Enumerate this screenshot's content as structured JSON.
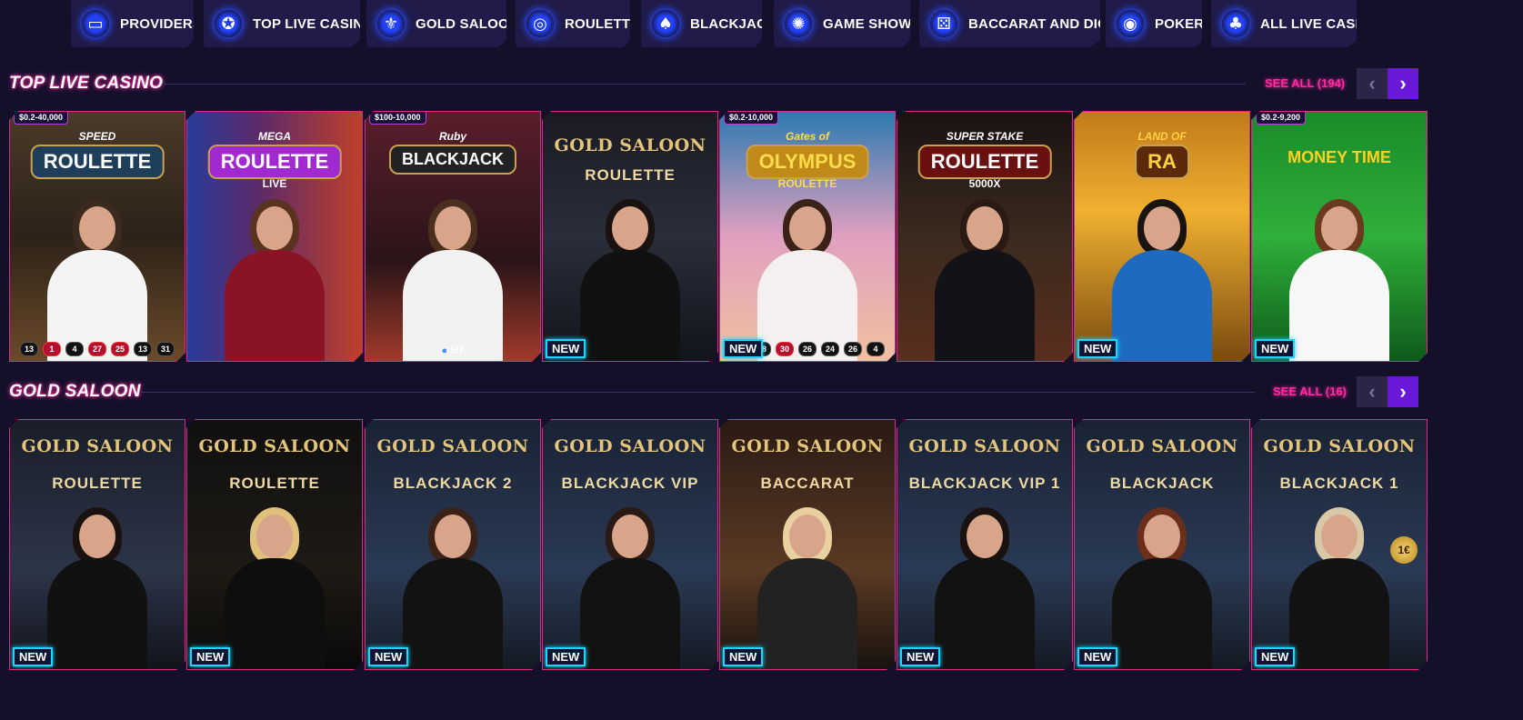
{
  "nav": [
    {
      "label": "PROVIDERS",
      "icon": "folder-icon",
      "glyph": "▭"
    },
    {
      "label": "TOP LIVE CASINO",
      "icon": "award-ribbon-icon",
      "glyph": "✪"
    },
    {
      "label": "GOLD SALOON",
      "icon": "fleur-de-lis-icon",
      "glyph": "⚜"
    },
    {
      "label": "ROULETTE",
      "icon": "roulette-wheel-icon",
      "glyph": "◎"
    },
    {
      "label": "BLACKJACK",
      "icon": "spade-icon",
      "glyph": "♠"
    },
    {
      "label": "GAME SHOWS",
      "icon": "wheel-icon",
      "glyph": "✺"
    },
    {
      "label": "BACCARAT AND DICE",
      "icon": "dice-icon",
      "glyph": "⚄"
    },
    {
      "label": "POKER",
      "icon": "poker-chip-icon",
      "glyph": "◉"
    },
    {
      "label": "ALL LIVE CASINO",
      "icon": "cherries-icon",
      "glyph": "♣"
    }
  ],
  "colors": {
    "accent": "#ff2aa1",
    "next_button": "#6a18d8",
    "new_badge_border": "#19d7ff",
    "background": "#14102a"
  },
  "sections": [
    {
      "title": "TOP LIVE CASINO",
      "see_all": "SEE ALL (194)",
      "prev_glyph": "‹",
      "next_glyph": "›",
      "cards": [
        {
          "title": "ROULETTE",
          "pre": "SPEED",
          "limit": "$0.2-40,000",
          "new": "",
          "results": [
            {
              "n": "13",
              "c": "black"
            },
            {
              "n": "1",
              "c": "red"
            },
            {
              "n": "4",
              "c": "black"
            },
            {
              "n": "27",
              "c": "red"
            },
            {
              "n": "25",
              "c": "red"
            },
            {
              "n": "13",
              "c": "black"
            },
            {
              "n": "31",
              "c": "black"
            }
          ],
          "players": ""
        },
        {
          "title": "ROULETTE",
          "pre": "MEGA",
          "post": "LIVE",
          "limit": "",
          "new": "",
          "results": [],
          "players": ""
        },
        {
          "title": "BLACKJACK",
          "pre": "Ruby",
          "limit": "$100-10,000",
          "new": "",
          "results": [],
          "players": "5/7"
        },
        {
          "title": "ROULETTE",
          "logo": "GOLD SALOON",
          "limit": "",
          "new": "NEW",
          "results": [],
          "players": ""
        },
        {
          "title": "OLYMPUS",
          "pre": "Gates of",
          "post": "ROULETTE",
          "limit": "$0.2-10,000",
          "new": "NEW",
          "results": [
            {
              "n": "3",
              "c": "red"
            },
            {
              "n": "28",
              "c": "black"
            },
            {
              "n": "30",
              "c": "red"
            },
            {
              "n": "26",
              "c": "black"
            },
            {
              "n": "24",
              "c": "black"
            },
            {
              "n": "26",
              "c": "black"
            },
            {
              "n": "4",
              "c": "black"
            }
          ],
          "players": ""
        },
        {
          "title": "ROULETTE",
          "pre": "SUPER STAKE",
          "post": "5000X",
          "limit": "",
          "new": "",
          "results": [],
          "players": ""
        },
        {
          "title": "RA",
          "pre": "LAND OF",
          "limit": "",
          "new": "NEW",
          "results": [],
          "players": ""
        },
        {
          "title": "MONEY TIME",
          "limit": "$0.2-9,200",
          "new": "NEW",
          "results": [],
          "players": ""
        }
      ]
    },
    {
      "title": "GOLD SALOON",
      "see_all": "SEE ALL (16)",
      "prev_glyph": "‹",
      "next_glyph": "›",
      "cards": [
        {
          "logo": "GOLD SALOON",
          "title": "ROULETTE",
          "new": "NEW"
        },
        {
          "logo": "GOLD SALOON",
          "title": "ROULETTE",
          "new": "NEW"
        },
        {
          "logo": "GOLD SALOON",
          "title": "BLACKJACK 2",
          "new": "NEW"
        },
        {
          "logo": "GOLD SALOON",
          "title": "BLACKJACK VIP",
          "new": "NEW"
        },
        {
          "logo": "GOLD SALOON",
          "title": "BACCARAT",
          "new": "NEW"
        },
        {
          "logo": "GOLD SALOON",
          "title": "BLACKJACK VIP 1",
          "new": "NEW"
        },
        {
          "logo": "GOLD SALOON",
          "title": "BLACKJACK",
          "new": "NEW"
        },
        {
          "logo": "GOLD SALOON",
          "title": "BLACKJACK 1",
          "new": "NEW",
          "chip": "1€"
        }
      ]
    }
  ]
}
